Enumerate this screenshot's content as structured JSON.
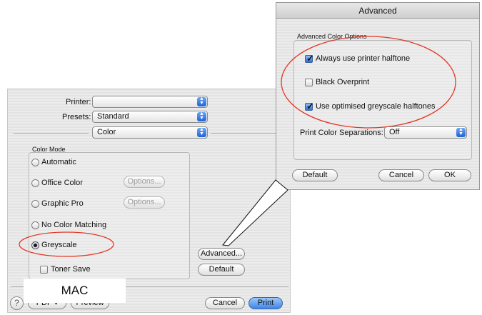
{
  "print_dialog": {
    "printer_label": "Printer:",
    "printer_value": "",
    "presets_label": "Presets:",
    "presets_value": "Standard",
    "panel_value": "Color",
    "color_mode_title": "Color Mode",
    "options": [
      {
        "label": "Automatic",
        "selected": false
      },
      {
        "label": "Office Color",
        "selected": false
      },
      {
        "label": "Graphic Pro",
        "selected": false
      },
      {
        "label": "No Color Matching",
        "selected": false
      },
      {
        "label": "Greyscale",
        "selected": true
      }
    ],
    "options_button_label": "Options...",
    "advanced_button_label": "Advanced...",
    "default_button_label": "Default",
    "toner_save_label": "Toner Save",
    "toner_save_checked": false,
    "help_label": "?",
    "pdf_label": "PDF ▾",
    "preview_label": "Preview",
    "cancel_label": "Cancel",
    "print_label": "Print",
    "mac_caption": "MAC"
  },
  "advanced_dialog": {
    "title": "Advanced",
    "group_title": "Advanced Color Options",
    "checkboxes": [
      {
        "label": "Always use printer halftone",
        "checked": true
      },
      {
        "label": "Black Overprint",
        "checked": false
      },
      {
        "label": "Use optimised greyscale halftones",
        "checked": true
      }
    ],
    "separations_label": "Print Color Separations:",
    "separations_value": "Off",
    "default_label": "Default",
    "cancel_label": "Cancel",
    "ok_label": "OK"
  },
  "colors": {
    "annotation_red": "#e23a2a",
    "accent_blue": "#2b6fe0"
  }
}
